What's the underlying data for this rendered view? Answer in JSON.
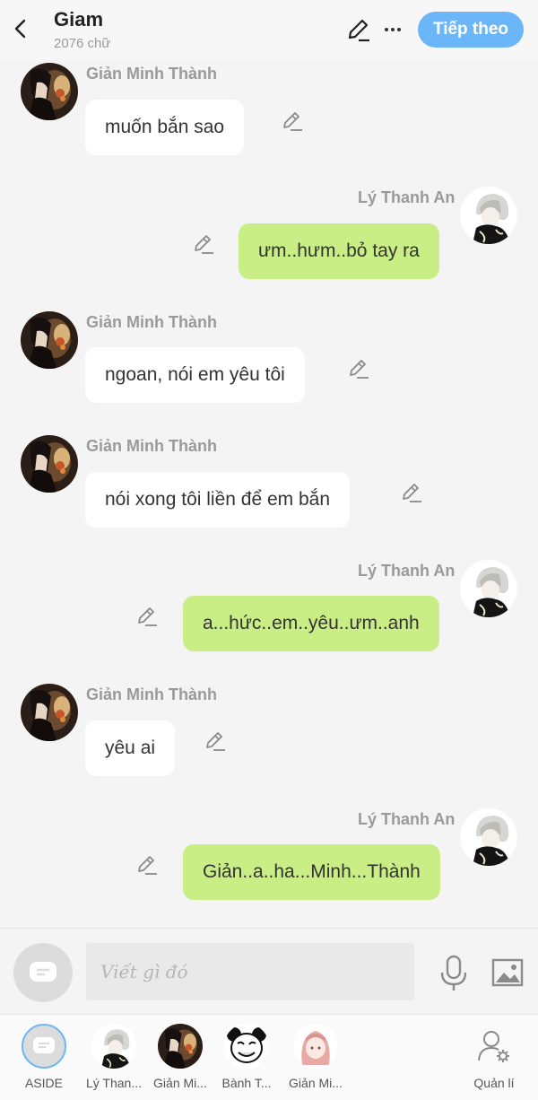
{
  "header": {
    "title": "Giam",
    "word_count": "2076 chữ",
    "next_label": "Tiếp theo"
  },
  "messages": [
    {
      "side": "left",
      "sender": "Giản Minh Thành",
      "text": "muốn bắn sao"
    },
    {
      "side": "right",
      "sender": "Lý Thanh An",
      "text": "ưm..hưm..bỏ tay ra"
    },
    {
      "side": "left",
      "sender": "Giản Minh Thành",
      "text": "ngoan, nói em yêu tôi"
    },
    {
      "side": "left",
      "sender": "Giản Minh Thành",
      "text": "nói xong tôi liền để em bắn"
    },
    {
      "side": "right",
      "sender": "Lý Thanh An",
      "text": "a...hức..em..yêu..ưm..anh"
    },
    {
      "side": "left",
      "sender": "Giản Minh Thành",
      "text": "yêu ai"
    },
    {
      "side": "right",
      "sender": "Lý Thanh An",
      "text": "Giản..a..ha...Minh...Thành"
    }
  ],
  "composer": {
    "placeholder": "Viết gì đó"
  },
  "tabs": [
    {
      "label": "ASIDE",
      "icon": "aside-chat-icon"
    },
    {
      "label": "Lý Than...",
      "icon": "ly-thanh-an-avatar"
    },
    {
      "label": "Giản Mi...",
      "icon": "gian-minh-thanh-avatar"
    },
    {
      "label": "Bành T...",
      "icon": "meme-face-avatar"
    },
    {
      "label": "Giản Mi...",
      "icon": "pink-hair-girl-avatar"
    },
    {
      "label": "Quản lí",
      "icon": "user-settings-icon"
    }
  ],
  "colors": {
    "accent": "#6ab6f8",
    "right_bubble": "#c9ee86",
    "left_bubble": "#ffffff",
    "background": "#f4f4f4"
  }
}
